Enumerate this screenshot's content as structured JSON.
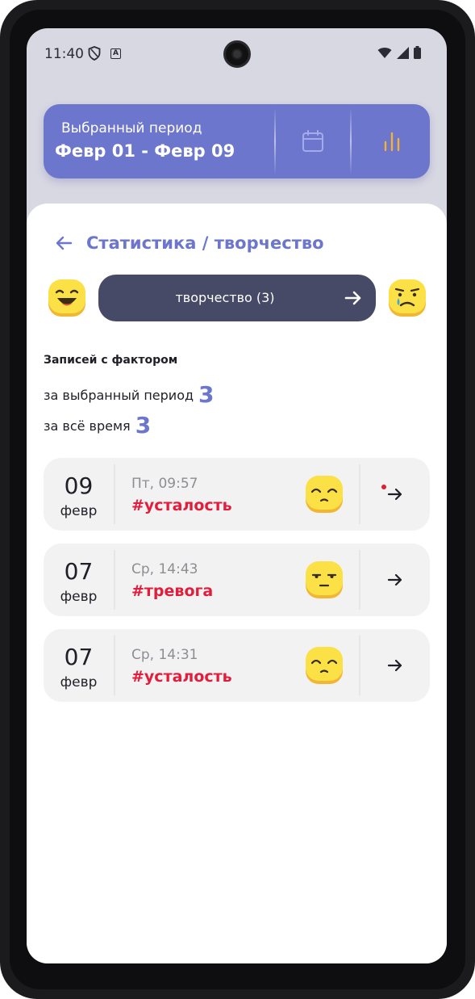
{
  "status_bar": {
    "time": "11:40",
    "a_badge": "A"
  },
  "period": {
    "label": "Выбранный период",
    "range": "Февр 01 - Февр 09",
    "calendar_icon": "calendar-icon",
    "stats_icon": "bar-chart-icon",
    "accent": "#6c76cc",
    "stats_icon_color": "#f2b233"
  },
  "header": {
    "title": "Статистика / творчество"
  },
  "factor": {
    "label": "творчество (3)",
    "left_emoji": "happy-face-icon",
    "right_emoji": "crying-face-icon"
  },
  "stats": {
    "heading": "Записей с фактором",
    "period_label": "за выбранный период",
    "period_count": "3",
    "all_time_label": "за всё время",
    "all_time_count": "3"
  },
  "entries": [
    {
      "day": "09",
      "month": "февр",
      "time": "Пт, 09:57",
      "tag": "#усталость",
      "mood": "sad-face-icon",
      "has_dot": true
    },
    {
      "day": "07",
      "month": "февр",
      "time": "Ср, 14:43",
      "tag": "#тревога",
      "mood": "neutral-face-icon",
      "has_dot": false
    },
    {
      "day": "07",
      "month": "февр",
      "time": "Ср, 14:31",
      "tag": "#усталость",
      "mood": "sad-face-icon",
      "has_dot": false
    }
  ]
}
